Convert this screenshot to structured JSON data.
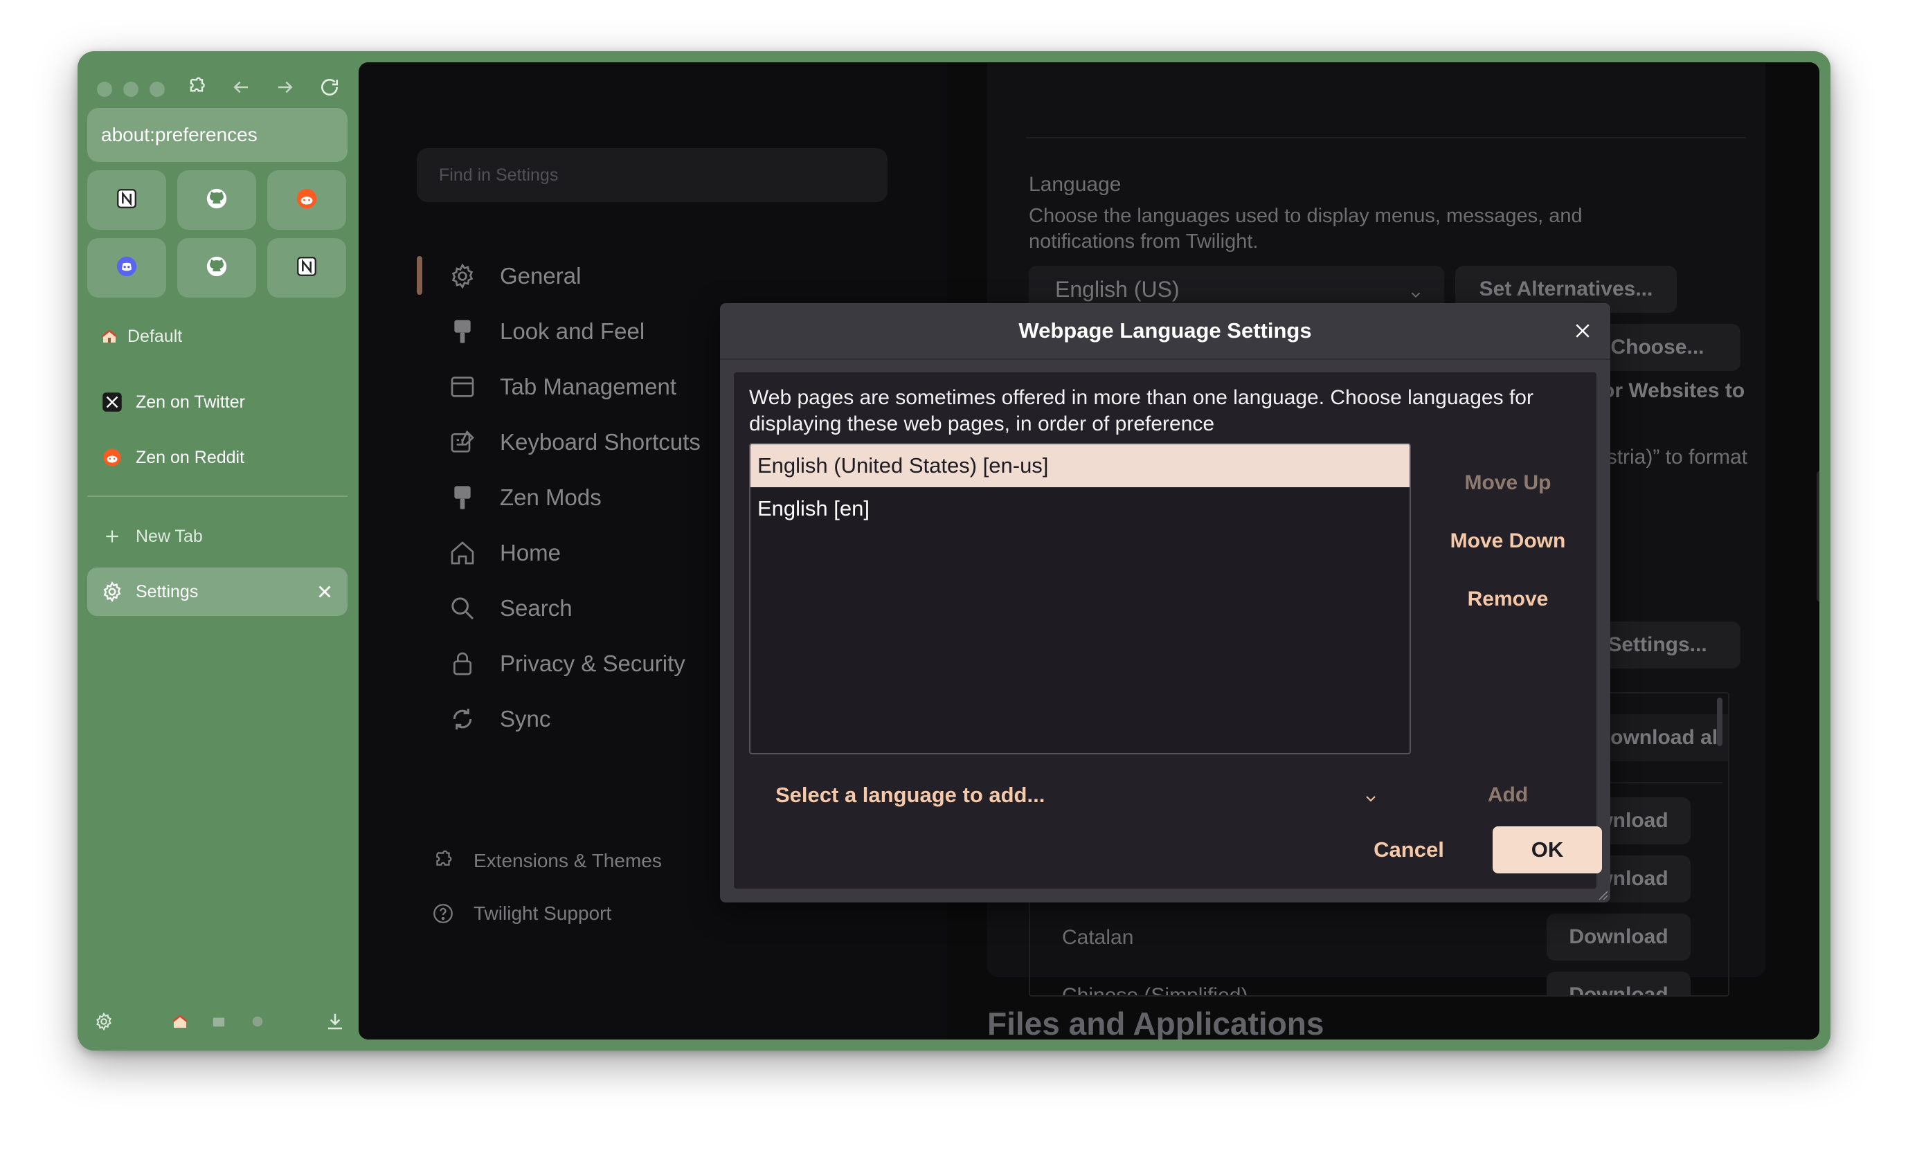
{
  "sidebar": {
    "url": "about:preferences",
    "pinned": [
      {
        "icon": "notion-icon"
      },
      {
        "icon": "github-icon"
      },
      {
        "icon": "reddit-icon"
      },
      {
        "icon": "discord-icon"
      },
      {
        "icon": "github-icon"
      },
      {
        "icon": "notion-icon"
      }
    ],
    "workspace_label": "Default",
    "tabs": [
      {
        "label": "Zen on Twitter",
        "icon": "x-icon"
      },
      {
        "label": "Zen on Reddit",
        "icon": "reddit-icon"
      }
    ],
    "new_tab_label": "New Tab",
    "active_tab_label": "Settings"
  },
  "settings": {
    "search_placeholder": "Find in Settings",
    "nav": [
      {
        "label": "General",
        "icon": "gear-icon"
      },
      {
        "label": "Look and Feel",
        "icon": "brush-icon"
      },
      {
        "label": "Tab Management",
        "icon": "tab-icon"
      },
      {
        "label": "Keyboard Shortcuts",
        "icon": "keyboard-edit-icon"
      },
      {
        "label": "Zen Mods",
        "icon": "brush-icon"
      },
      {
        "label": "Home",
        "icon": "home-icon"
      },
      {
        "label": "Search",
        "icon": "search-icon"
      },
      {
        "label": "Privacy & Security",
        "icon": "lock-icon"
      },
      {
        "label": "Sync",
        "icon": "sync-icon"
      }
    ],
    "footer": [
      {
        "label": "Extensions & Themes",
        "icon": "puzzle-icon"
      },
      {
        "label": "Twilight Support",
        "icon": "help-icon"
      }
    ],
    "language": {
      "heading": "Language",
      "description": "Choose the languages used to display menus, messages, and notifications from Twilight.",
      "selected": "English (US)",
      "set_alternatives": "Set Alternatives...",
      "choose": "Choose...",
      "websites_fragment": "r for Websites to",
      "format_fragment": "Austria)” to format",
      "settings_btn": "Settings...",
      "download_all": "Download all",
      "download_items": [
        {
          "name": "",
          "button": "Download"
        },
        {
          "name": "",
          "button": "Download"
        },
        {
          "name": "Catalan",
          "button": "Download"
        },
        {
          "name": "Chinese (Simplified)",
          "button": "Download"
        }
      ],
      "next_section": "Files and Applications"
    }
  },
  "dialog": {
    "title": "Webpage Language Settings",
    "description": "Web pages are sometimes offered in more than one language. Choose languages for displaying these web pages, in order of preference",
    "languages": [
      "English (United States) [en-us]",
      "English [en]"
    ],
    "move_up": "Move Up",
    "move_down": "Move Down",
    "remove": "Remove",
    "select_placeholder": "Select a language to add...",
    "add": "Add",
    "cancel": "Cancel",
    "ok": "OK"
  }
}
